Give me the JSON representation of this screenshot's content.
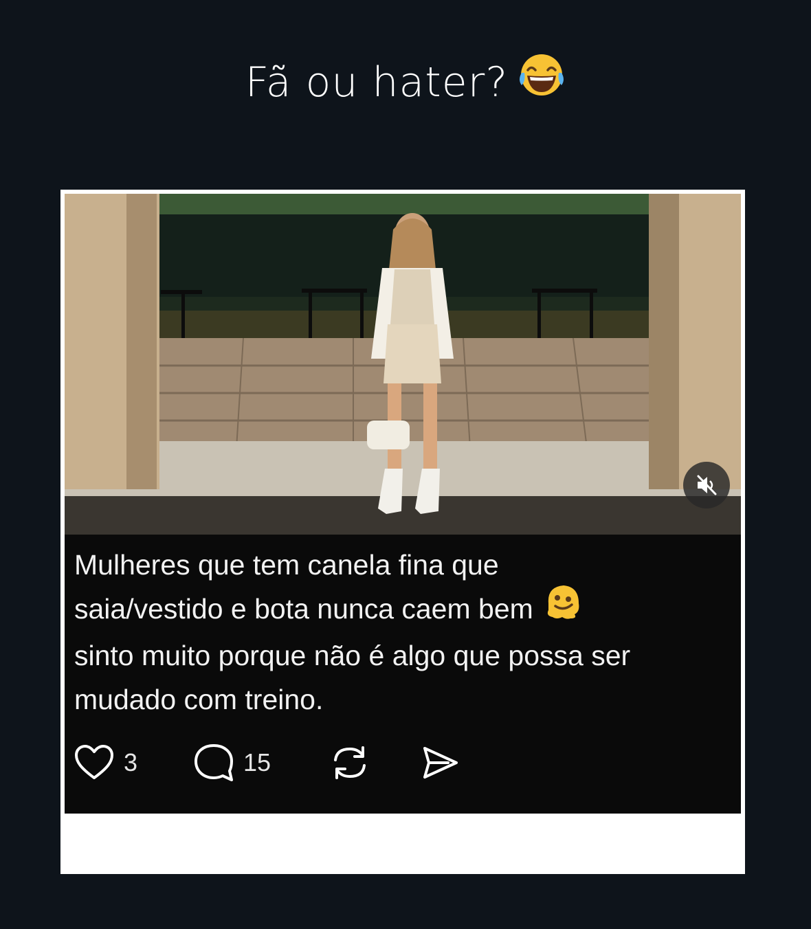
{
  "story": {
    "caption": "Fã ou hater?",
    "caption_emoji": "laughing-crying-emoji"
  },
  "post": {
    "text_lines": [
      "Mulheres que tem canela fina que",
      "saia/vestido e bota nunca caem bem",
      "sinto muito porque não é algo que possa ser",
      "mudado com treino."
    ],
    "inline_emoji": "melting-face-emoji",
    "media": {
      "type": "video",
      "muted": true,
      "mute_icon": "speaker-muted-icon"
    },
    "actions": {
      "likes": "3",
      "comments": "15",
      "like_icon": "heart-icon",
      "comment_icon": "comment-bubble-icon",
      "repost_icon": "repost-icon",
      "share_icon": "send-icon"
    }
  },
  "colors": {
    "background": "#0e141b",
    "card_border": "#ffffff",
    "post_background": "#0a0a0a",
    "text": "#f2f2f2"
  }
}
